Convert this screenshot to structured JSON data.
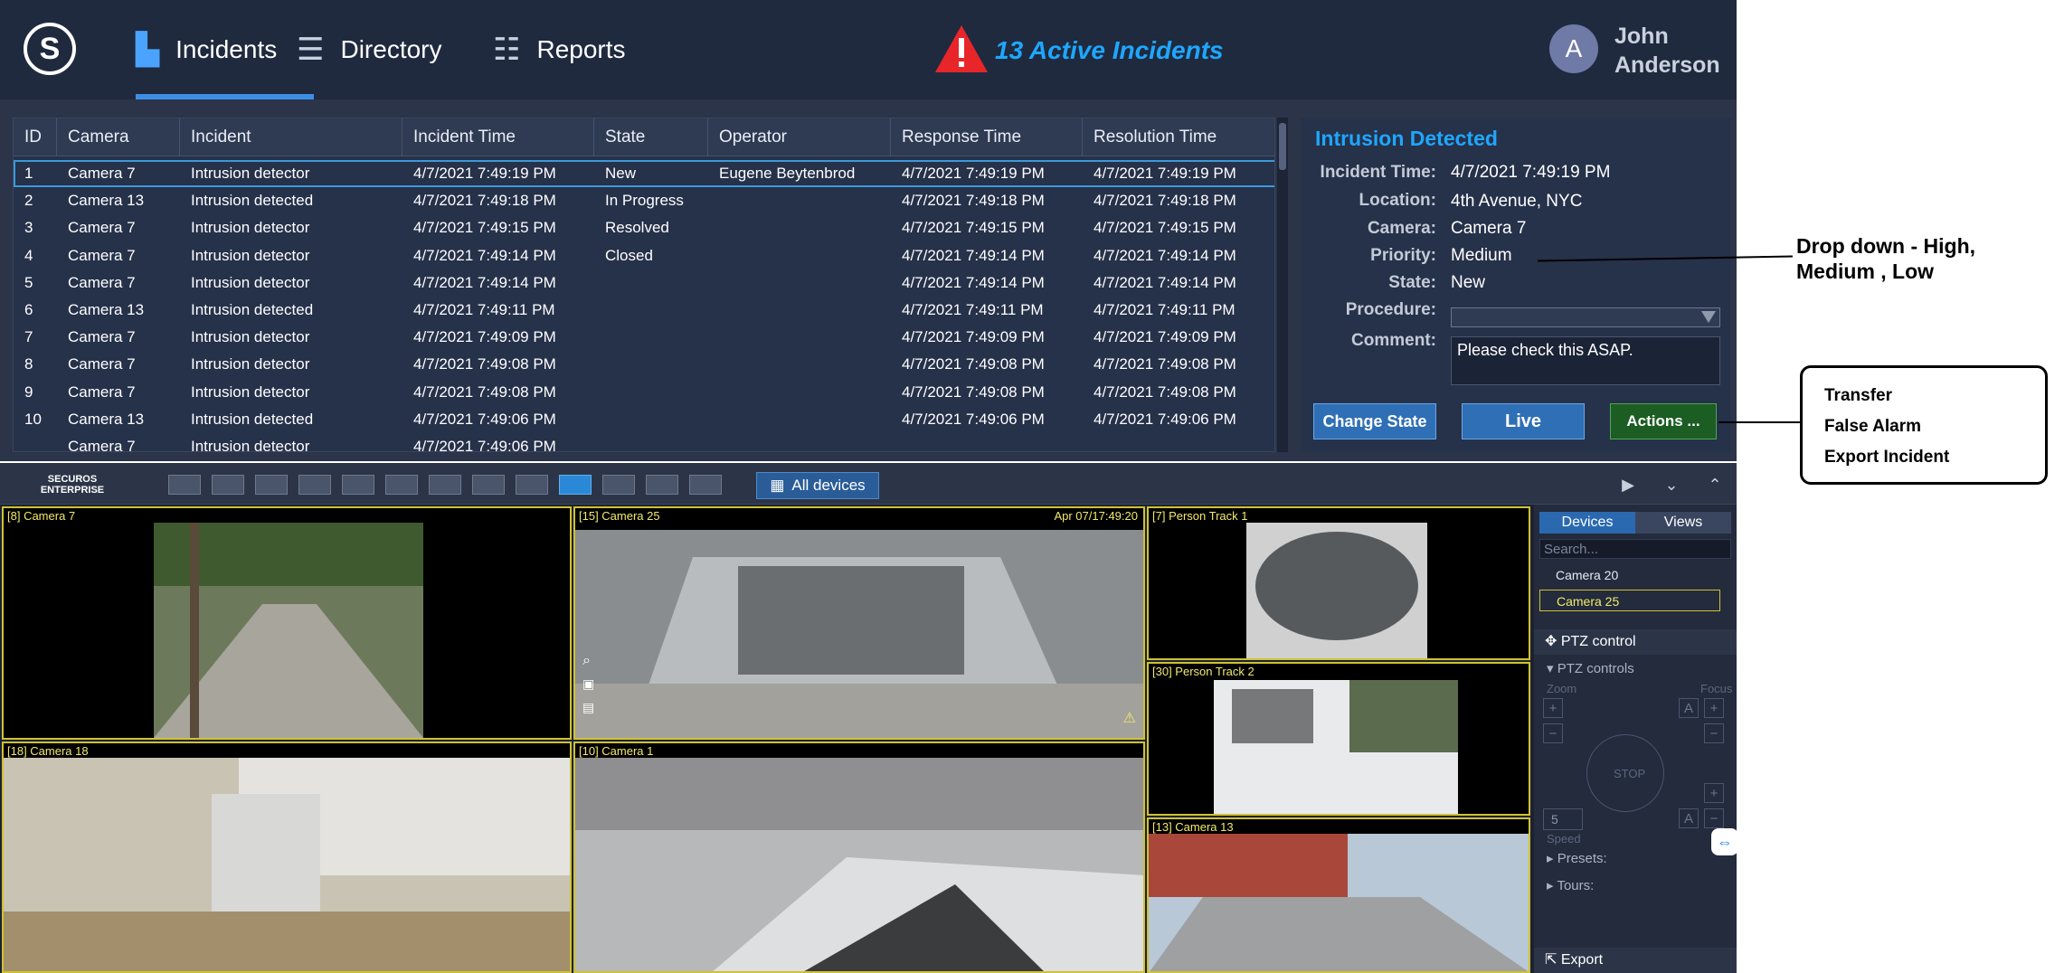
{
  "nav": {
    "logo_letter": "S",
    "incidents": "Incidents",
    "directory": "Directory",
    "reports": "Reports",
    "active_incidents": "13 Active Incidents",
    "user_initial": "A",
    "user_first": "John",
    "user_last": "Anderson"
  },
  "table": {
    "headers": [
      "ID",
      "Camera",
      "Incident",
      "Incident Time",
      "State",
      "Operator",
      "Response Time",
      "Resolution Time"
    ],
    "rows": [
      [
        "1",
        "Camera 7",
        "Intrusion detector",
        "4/7/2021  7:49:19 PM",
        "New",
        "Eugene Beytenbrod",
        "4/7/2021  7:49:19 PM",
        "4/7/2021  7:49:19 PM"
      ],
      [
        "2",
        "Camera 13",
        "Intrusion detected",
        "4/7/2021  7:49:18 PM",
        "In Progress",
        "",
        "4/7/2021  7:49:18 PM",
        "4/7/2021  7:49:18 PM"
      ],
      [
        "3",
        "Camera 7",
        "Intrusion detector",
        "4/7/2021  7:49:15 PM",
        "Resolved",
        "",
        "4/7/2021  7:49:15 PM",
        "4/7/2021  7:49:15 PM"
      ],
      [
        "4",
        "Camera 7",
        "Intrusion detector",
        "4/7/2021  7:49:14 PM",
        "Closed",
        "",
        "4/7/2021  7:49:14 PM",
        "4/7/2021  7:49:14 PM"
      ],
      [
        "5",
        "Camera 7",
        "Intrusion detector",
        "4/7/2021  7:49:14 PM",
        "",
        "",
        "4/7/2021  7:49:14 PM",
        "4/7/2021  7:49:14 PM"
      ],
      [
        "6",
        "Camera 13",
        "Intrusion detected",
        "4/7/2021  7:49:11 PM",
        "",
        "",
        "4/7/2021  7:49:11 PM",
        "4/7/2021  7:49:11 PM"
      ],
      [
        "7",
        "Camera 7",
        "Intrusion detector",
        "4/7/2021  7:49:09 PM",
        "",
        "",
        "4/7/2021  7:49:09 PM",
        "4/7/2021  7:49:09 PM"
      ],
      [
        "8",
        "Camera 7",
        "Intrusion detector",
        "4/7/2021  7:49:08 PM",
        "",
        "",
        "4/7/2021  7:49:08 PM",
        "4/7/2021  7:49:08 PM"
      ],
      [
        "9",
        "Camera 7",
        "Intrusion detector",
        "4/7/2021  7:49:08 PM",
        "",
        "",
        "4/7/2021  7:49:08 PM",
        "4/7/2021  7:49:08 PM"
      ],
      [
        "10",
        "Camera 13",
        "Intrusion detected",
        "4/7/2021  7:49:06 PM",
        "",
        "",
        "4/7/2021  7:49:06 PM",
        "4/7/2021  7:49:06 PM"
      ],
      [
        "",
        "Camera 7",
        "Intrusion detector",
        "4/7/2021  7:49:06 PM",
        "",
        "",
        "",
        ""
      ]
    ]
  },
  "details": {
    "title": "Intrusion Detected",
    "incident_time_label": "Incident Time:",
    "incident_time": "4/7/2021  7:49:19 PM",
    "location_label": "Location:",
    "location": "4th Avenue, NYC",
    "camera_label": "Camera:",
    "camera": "Camera 7",
    "priority_label": "Priority:",
    "priority": "Medium",
    "state_label": "State:",
    "state": "New",
    "procedure_label": "Procedure:",
    "procedure": "",
    "comment_label": "Comment:",
    "comment": "Please check this ASAP.",
    "change_state": "Change State",
    "live": "Live",
    "actions": "Actions ..."
  },
  "annotations": {
    "dropdown_note_1": "Drop down - High,",
    "dropdown_note_2": "Medium , Low",
    "action_transfer": "Transfer",
    "action_false_alarm": "False Alarm",
    "action_export": "Export Incident"
  },
  "viewer": {
    "brand_1": "SECUROS",
    "brand_2": "ENTERPRISE",
    "all_devices": "All devices",
    "cameras": [
      {
        "label": "[8] Camera 7",
        "ts": ""
      },
      {
        "label": "[15] Camera 25",
        "ts": "Apr 07/17:49:20"
      },
      {
        "label": "[7] Person Track 1",
        "ts": ""
      },
      {
        "label": "[30] Person Track 2",
        "ts": ""
      },
      {
        "label": "[18] Camera 18",
        "ts": ""
      },
      {
        "label": "[10] Camera 1",
        "ts": ""
      },
      {
        "label": "[13] Camera 13",
        "ts": ""
      }
    ]
  },
  "side": {
    "tab_devices": "Devices",
    "tab_views": "Views",
    "search_placeholder": "Search...",
    "devices": [
      "Camera 20",
      "Camera 25"
    ],
    "ptz_control": "PTZ control",
    "ptz_controls": "PTZ controls",
    "zoom": "Zoom",
    "focus": "Focus",
    "stop": "STOP",
    "speed_value": "5",
    "speed": "Speed",
    "presets": "Presets:",
    "tours": "Tours:",
    "export": "Export"
  },
  "colors": {
    "accent": "#1ea7ff",
    "topbar": "#1f2a3f",
    "panel": "#26314a",
    "camera_border": "#cfc233",
    "warning": "#e8262a"
  }
}
